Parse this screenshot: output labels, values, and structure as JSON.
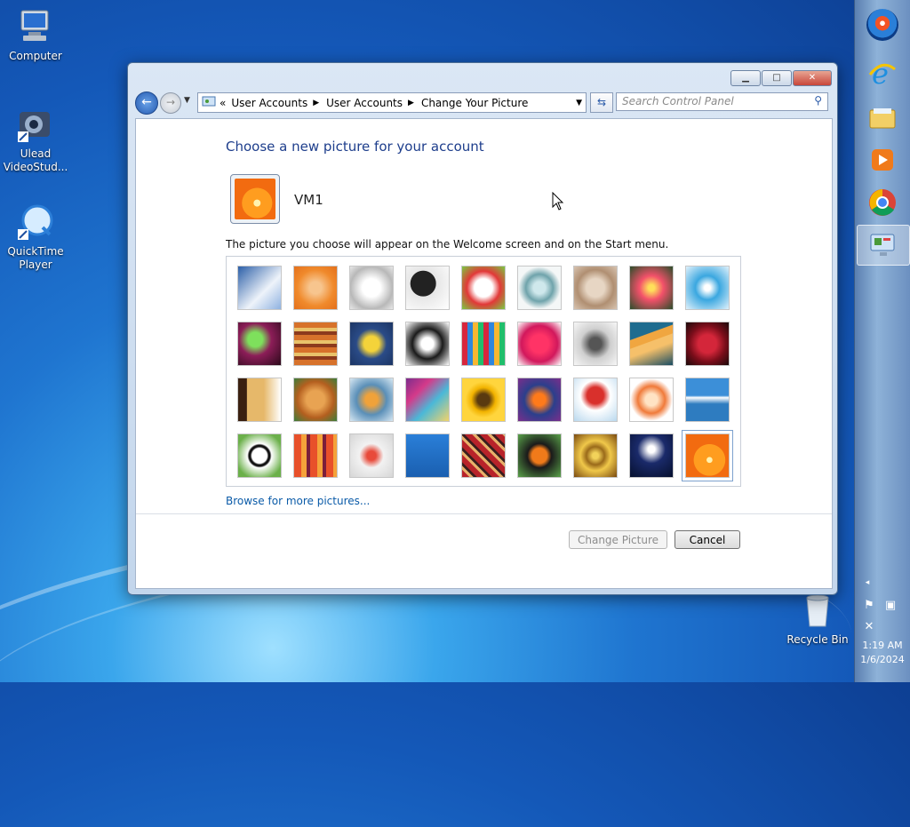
{
  "desktop": {
    "icons": [
      {
        "label": "Computer"
      },
      {
        "label": "Ulead VideoStud..."
      },
      {
        "label": "QuickTime Player"
      },
      {
        "label": "Recycle Bin"
      }
    ]
  },
  "window": {
    "controls": {
      "minimize": "▁",
      "maximize": "□",
      "close": "✕"
    },
    "breadcrumb": [
      "User Accounts",
      "User Accounts",
      "Change Your Picture"
    ],
    "breadcrumb_prefix": "«",
    "search_placeholder": "Search Control Panel",
    "heading": "Choose a new picture for your account",
    "username": "VM1",
    "description": "The picture you choose will appear on the Welcome screen and on the Start menu.",
    "browse_link": "Browse for more pictures...",
    "buttons": {
      "change": "Change Picture",
      "cancel": "Cancel"
    },
    "pictures": [
      {
        "name": "roller-coaster",
        "bg": "linear-gradient(135deg,#2c5fa8,#eef3fa 60%,#8fb2e0)"
      },
      {
        "name": "starfish",
        "bg": "radial-gradient(circle,#f7c58e 20%,#f08a2c 60%,#e4701c)"
      },
      {
        "name": "robot-dog",
        "bg": "radial-gradient(circle,#ffffff 30%,#b8b8b8 70%,#e8e8e8)"
      },
      {
        "name": "record-player",
        "bg": "radial-gradient(circle at 40% 40%,#222 35%,#e6e6e6 36%,#ffffff)"
      },
      {
        "name": "lucky-cat",
        "bg": "radial-gradient(circle,#ffffff 30%,#e23838 55%,#7ac943)"
      },
      {
        "name": "gyroscope",
        "bg": "radial-gradient(circle,#cfe8ec 20%,#6fa3ab 45%,#f4f7f7 70%)"
      },
      {
        "name": "kitten",
        "bg": "radial-gradient(circle,#e7d6c4 30%,#b08f72 60%,#d7c3b0)"
      },
      {
        "name": "flower",
        "bg": "radial-gradient(circle,#ffdf5a 10%,#f3516a 40%,#2a4d2a)"
      },
      {
        "name": "pinwheel",
        "bg": "radial-gradient(circle,#ffffff 10%,#3aa7e0 40%,#e0f1fb)"
      },
      {
        "name": "ball",
        "bg": "radial-gradient(circle at 40% 40%,#7ee05c 20%,#8c1d58 45%,#2b0a1a)"
      },
      {
        "name": "fabric-stack",
        "bg": "repeating-linear-gradient(0deg,#d7722b 0 6px,#8c3a1d 6px 10px,#e9c26a 10px 14px)"
      },
      {
        "name": "leaf",
        "bg": "radial-gradient(circle,#f4d33a 25%,#2a4b87 50%,#1c3564)"
      },
      {
        "name": "dog",
        "bg": "radial-gradient(circle,#ffffff 20%,#1a1a1a 50%,#ffffff)"
      },
      {
        "name": "crayons",
        "bg": "repeating-linear-gradient(90deg,#d7263d 0 6px,#2e86de 6px 12px,#f7b731 12px 18px,#20bf6b 18px 24px)"
      },
      {
        "name": "star",
        "bg": "radial-gradient(circle,#ff3366 30%,#d1185c 60%,#ffffff)"
      },
      {
        "name": "jacks",
        "bg": "radial-gradient(circle,#555 20%,#cfcfcf 50%,#f7f7f7)"
      },
      {
        "name": "stairs",
        "bg": "linear-gradient(160deg,#1f6c8f 30%,#f0a640 31% 45%,#f6c06a 46% 60%,#1a4d63)"
      },
      {
        "name": "crane",
        "bg": "radial-gradient(circle,#d4263a 30%,#7a0d1a 60%,#1a0a0a)"
      },
      {
        "name": "guitar",
        "bg": "linear-gradient(90deg,#3a2010 20%,#e6b86a 21% 60%,#ffffff)"
      },
      {
        "name": "puppy",
        "bg": "radial-gradient(circle,#e8a352 30%,#b45f1f 60%,#3c7d3a)"
      },
      {
        "name": "robot-toy",
        "bg": "radial-gradient(circle,#f0a23a 20%,#5a8fb8 50%,#d6e7f2)"
      },
      {
        "name": "scarf",
        "bg": "linear-gradient(135deg,#7c2c8c,#d43a8a 30%,#4ab8d8 60%,#f2d36a)"
      },
      {
        "name": "sunflower",
        "bg": "radial-gradient(circle,#5a3a10 20%,#f2b300 40%,#ffd53d 60%)"
      },
      {
        "name": "fish",
        "bg": "radial-gradient(circle,#ff7a1a 20%,#2b3f8c 50%,#7b2f8c)"
      },
      {
        "name": "balloon",
        "bg": "radial-gradient(circle at 50% 40%,#d9302c 25%,#ffffff 45%,#b9d8ee)"
      },
      {
        "name": "character",
        "bg": "radial-gradient(circle,#ffe3c4 20%,#f07a3a 45%,#ffffff 70%)"
      },
      {
        "name": "sailboat",
        "bg": "linear-gradient(180deg,#3c8fd8 40%,#ffffff 45%,#2e7cc0 60%)"
      },
      {
        "name": "soccer-ball",
        "bg": "radial-gradient(circle,#ffffff 25%,#111 30% 35%,#ffffff 40%,#6bb04a 80%)"
      },
      {
        "name": "fabric",
        "bg": "repeating-linear-gradient(90deg,#e8502a 0 8px,#f5a23a 8px 14px,#7b1e3a 14px 18px)"
      },
      {
        "name": "marbles",
        "bg": "radial-gradient(circle,#e84a3a 15%,#f2f2f2 40%,#d6d6d6)"
      },
      {
        "name": "window",
        "bg": "linear-gradient(#2a7fd8,#1a5fb0)"
      },
      {
        "name": "textile",
        "bg": "repeating-linear-gradient(45deg,#b8232a 0 6px,#e7b06a 6px 9px,#3a1e1e 9px 12px)"
      },
      {
        "name": "butterfly",
        "bg": "radial-gradient(circle,#f07a1a 25%,#1a1a1a 40%,#5aa34a)"
      },
      {
        "name": "shell",
        "bg": "radial-gradient(circle,#f2d25a 10%,#9a6a1a 30%,#f0c84a 50%,#7a4a10)"
      },
      {
        "name": "lighthouse",
        "bg": "radial-gradient(circle at 50% 35%,#ffffff 10%,#1a2a6a 40%,#06102e)"
      },
      {
        "name": "flower-orange",
        "bg": "radial-gradient(circle at 55% 60%,#fff3b0 0 8%,#ff9d1f 9% 45%,#f26b10 46% 100%)"
      }
    ]
  },
  "taskbar": {
    "clock_time": "1:19 AM",
    "clock_date": "1/6/2024"
  }
}
